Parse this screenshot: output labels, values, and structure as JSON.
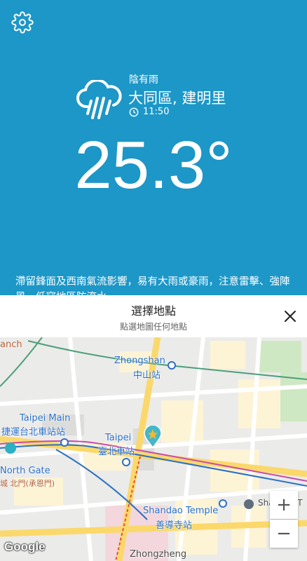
{
  "weather": {
    "condition": "陰有雨",
    "location": "大同區, 建明里",
    "time": "11:50",
    "temperature": "25.3°",
    "description": "滯留鋒面及西南氣流影響，易有大雨或豪雨，注意雷擊、強陣風，低窪地區防淹水",
    "background_color": "#1c97c7"
  },
  "sheet": {
    "title": "選擇地點",
    "subtitle": "點選地圖任何地點"
  },
  "map": {
    "labels": {
      "branch": "anch",
      "zhongshan_en": "Zhongshan",
      "zhongshan_zh": "中山站",
      "taipei_main_en": "Taipei Main",
      "taipei_main_zh": "捷運台北車站站",
      "taipei_en": "Taipei",
      "taipei_zh": "臺北車站",
      "north_gate_en": "North Gate",
      "north_gate_zh": "城 北門(承恩門)",
      "shandao_en": "Shandao Temple",
      "shandao_zh": "善導寺站",
      "shandao_right": "Shandao T",
      "zhongzheng": "Zhongzheng"
    },
    "zoom_in": "+",
    "zoom_out": "−",
    "attribution": "Google"
  },
  "icons": {
    "settings": "gear-icon",
    "weather": "cloud-rain-icon",
    "clock": "clock-icon",
    "close": "close-icon",
    "marker": "star-marker-icon"
  }
}
